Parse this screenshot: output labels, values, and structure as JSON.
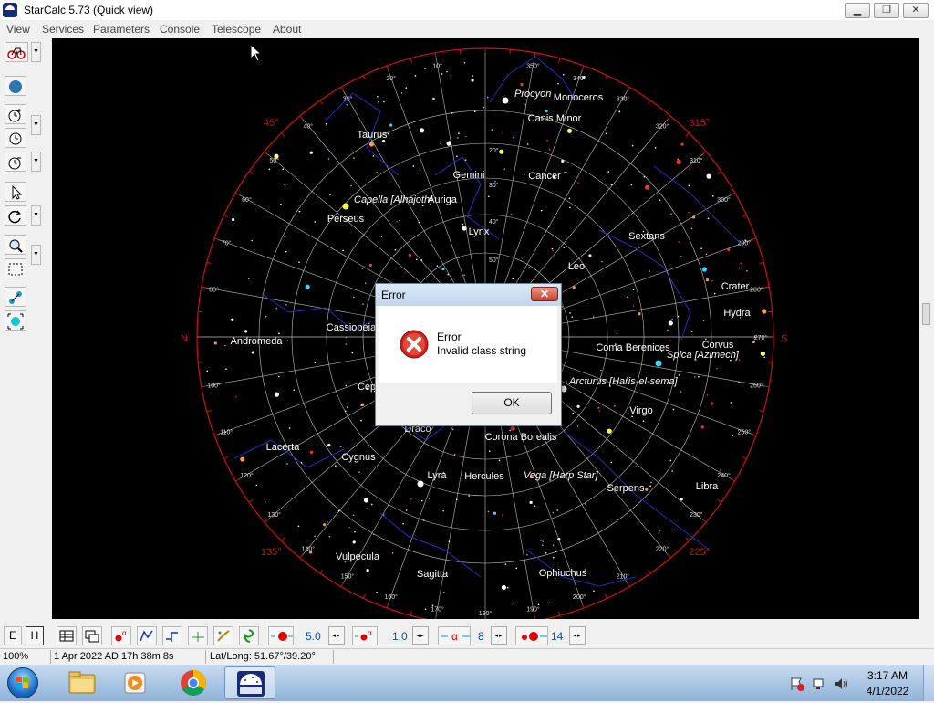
{
  "window": {
    "title": "StarCalc 5.73 (Quick view)",
    "minimize": "▁",
    "maximize": "❐",
    "close": "✕"
  },
  "menu": [
    "View",
    "Services",
    "Parameters",
    "Console",
    "Telescope",
    "About"
  ],
  "sky": {
    "directions": {
      "north": "N",
      "south": "S"
    },
    "azimuth_major": [
      {
        "label": "315°",
        "az": 315
      },
      {
        "label": "225°",
        "az": 225
      },
      {
        "label": "45°",
        "az": 45
      },
      {
        "label": "135°",
        "az": 135
      }
    ],
    "azimuth_ticks": [
      "10°",
      "20°",
      "30°",
      "40°",
      "50°",
      "60°",
      "70°",
      "80°",
      "100°",
      "110°",
      "120°",
      "130°",
      "140°",
      "150°",
      "160°",
      "170°",
      "180°",
      "190°",
      "200°",
      "210°",
      "220°",
      "230°",
      "240°",
      "250°",
      "260°",
      "270°",
      "280°",
      "290°",
      "300°",
      "310°",
      "320°",
      "330°",
      "340°",
      "350°"
    ],
    "altitude_ticks": [
      "20°",
      "30°",
      "40°",
      "50°",
      "60°"
    ],
    "constellations": [
      "Monoceros",
      "Canis Minor",
      "Taurus",
      "Gemini",
      "Cancer",
      "Auriga",
      "Perseus",
      "Lynx",
      "Sextans",
      "Leo",
      "Crater",
      "Hydra",
      "Andromeda",
      "Cassiopeia",
      "Corvus",
      "Coma Berenices",
      "Cepheus",
      "Virgo",
      "Draco",
      "Corona Borealis",
      "Lacerta",
      "Cygnus",
      "Lyra",
      "Hercules",
      "Serpens",
      "Libra",
      "Vulpecula",
      "Sagitta",
      "Ophiuchus"
    ],
    "stars": [
      "Procyon",
      "Capella [Alhajoth]",
      "Spica [Azimech]",
      "Arcturus [Haris-el-sema]",
      "Vega [Harp Star]"
    ],
    "colors": {
      "horizon": "#d01010",
      "grid": "#c0c0c0",
      "lines": "#1e2ec8",
      "labels": "#ffffff"
    }
  },
  "bottom_toolbar": {
    "e_label": "E",
    "h_label": "H",
    "spin1": "5.0",
    "spin2": "1.0",
    "spin3": "8",
    "spin4": "14",
    "spin_arrows": "◂▸"
  },
  "status": {
    "zoom": "100%",
    "datetime": "1 Apr 2022 AD 17h 38m 8s",
    "latlong": "Lat/Long: 51.67°/39.20°"
  },
  "dialog": {
    "title": "Error",
    "close": "✕",
    "heading": "Error",
    "message": "Invalid class string",
    "ok_label": "OK"
  },
  "taskbar": {
    "time": "3:17 AM",
    "date": "4/1/2022"
  }
}
